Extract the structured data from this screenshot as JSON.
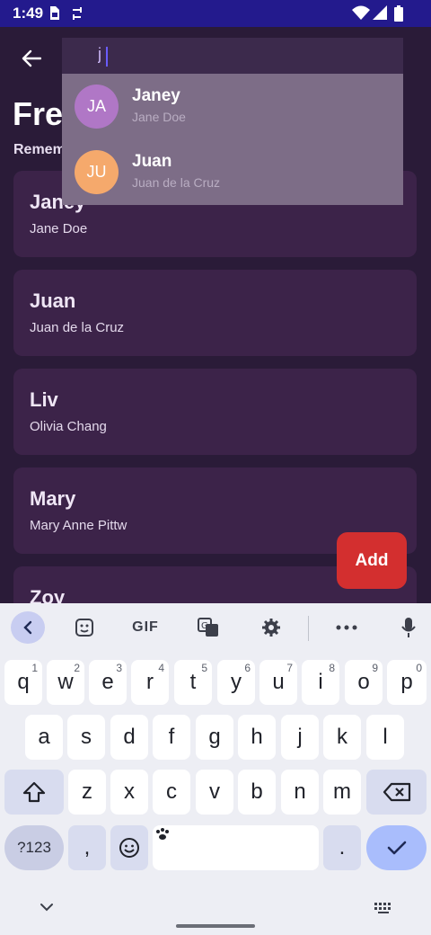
{
  "status_bar": {
    "time": "1:49"
  },
  "app": {
    "title": "Fre",
    "subtitle": "Remem",
    "cards": [
      {
        "nickname": "Janey",
        "full_name": "Jane Doe"
      },
      {
        "nickname": "Juan",
        "full_name": "Juan de la Cruz"
      },
      {
        "nickname": "Liv",
        "full_name": "Olivia Chang"
      },
      {
        "nickname": "Mary",
        "full_name": "Mary Anne Pittw"
      },
      {
        "nickname": "Zoy",
        "full_name": ""
      }
    ],
    "add_label": "Add"
  },
  "search": {
    "query": "j",
    "suggestions": [
      {
        "initials": "JA",
        "nickname": "Janey",
        "full_name": "Jane Doe",
        "avatar_color": "#b077c6"
      },
      {
        "initials": "JU",
        "nickname": "Juan",
        "full_name": "Juan de la Cruz",
        "avatar_color": "#f5a96c"
      }
    ]
  },
  "keyboard": {
    "toolbar": {
      "gif_label": "GIF"
    },
    "row1": [
      {
        "k": "q",
        "h": "1"
      },
      {
        "k": "w",
        "h": "2"
      },
      {
        "k": "e",
        "h": "3"
      },
      {
        "k": "r",
        "h": "4"
      },
      {
        "k": "t",
        "h": "5"
      },
      {
        "k": "y",
        "h": "6"
      },
      {
        "k": "u",
        "h": "7"
      },
      {
        "k": "i",
        "h": "8"
      },
      {
        "k": "o",
        "h": "9"
      },
      {
        "k": "p",
        "h": "0"
      }
    ],
    "row2": [
      "a",
      "s",
      "d",
      "f",
      "g",
      "h",
      "j",
      "k",
      "l"
    ],
    "row3": [
      "z",
      "x",
      "c",
      "v",
      "b",
      "n",
      "m"
    ],
    "symbols_label": "?123",
    "comma": ",",
    "period": "."
  },
  "colors": {
    "accent": "#d32f2f",
    "status_bar": "#231a8d",
    "card": "#3c2349"
  }
}
